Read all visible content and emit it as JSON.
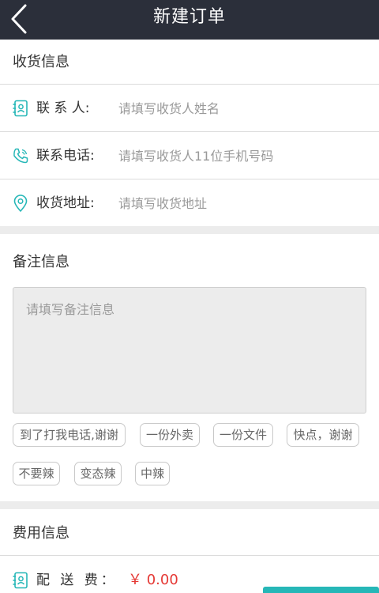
{
  "header": {
    "title": "新建订单"
  },
  "receiver": {
    "section_title": "收货信息",
    "fields": [
      {
        "label": "联 系 人:",
        "placeholder": "请填写收货人姓名",
        "value": ""
      },
      {
        "label": "联系电话:",
        "placeholder": "请填写收货人11位手机号码",
        "value": ""
      },
      {
        "label": "收货地址:",
        "placeholder": "请填写收货地址",
        "value": ""
      }
    ]
  },
  "remarks": {
    "section_title": "备注信息",
    "placeholder": "请填写备注信息",
    "tags": [
      "到了打我电话,谢谢",
      "一份外卖",
      "一份文件",
      "快点，谢谢",
      "不要辣",
      "变态辣",
      "中辣"
    ]
  },
  "fees": {
    "section_title": "费用信息",
    "delivery_label": "配 送 费：",
    "delivery_value": "￥ 0.00"
  },
  "colors": {
    "accent": "#26b7b7",
    "header_bg": "#2b2f3a",
    "price": "#e53935"
  }
}
